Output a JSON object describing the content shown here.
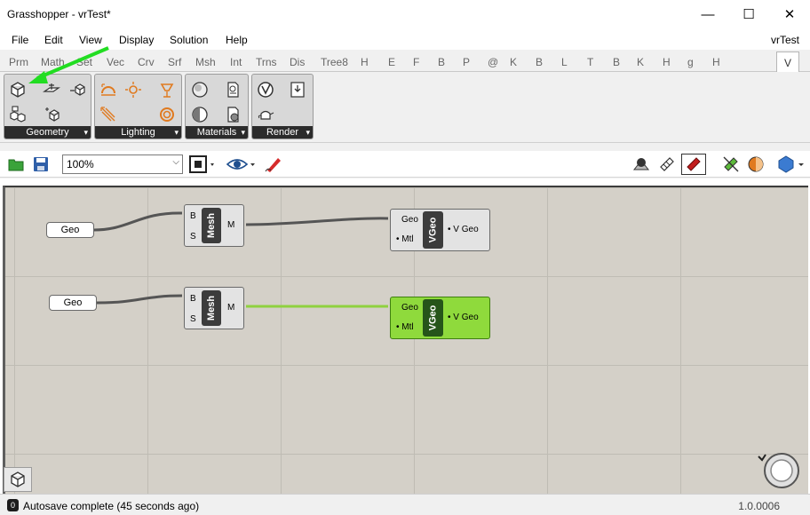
{
  "window": {
    "title": "Grasshopper - vrTest*",
    "file_name": "vrTest",
    "controls": {
      "minimize": "—",
      "maximize": "☐",
      "close": "✕"
    }
  },
  "menu": [
    "File",
    "Edit",
    "View",
    "Display",
    "Solution",
    "Help"
  ],
  "tabs": [
    "Prm",
    "Math",
    "Set",
    "Vec",
    "Crv",
    "Srf",
    "Msh",
    "Int",
    "Trns",
    "Dis",
    "Tree8",
    "H",
    "E",
    "F",
    "B",
    "P",
    "@",
    "K",
    "B",
    "L",
    "T",
    "B",
    "K",
    "H",
    "g",
    "H"
  ],
  "active_tab": "V",
  "ribbon": {
    "panels": [
      {
        "label": "Geometry",
        "dropdown": "▾"
      },
      {
        "label": "Lighting",
        "dropdown": "▾"
      },
      {
        "label": "Materials",
        "dropdown": "▾"
      },
      {
        "label": "Render",
        "dropdown": "▾"
      }
    ]
  },
  "toolbar": {
    "zoom_value": "100%",
    "chevron": "⌵"
  },
  "canvas": {
    "params": [
      {
        "label": "Geo"
      },
      {
        "label": "Geo"
      }
    ],
    "mesh_components": [
      {
        "name": "Mesh",
        "inputs": [
          "B",
          "S"
        ],
        "output": "M"
      },
      {
        "name": "Mesh",
        "inputs": [
          "B",
          "S"
        ],
        "output": "M"
      }
    ],
    "vgeo_components": [
      {
        "name": "VGeo",
        "inputs": [
          "Geo",
          "• Mtl"
        ],
        "output": "• V Geo",
        "selected": false
      },
      {
        "name": "VGeo",
        "inputs": [
          "Geo",
          "• Mtl"
        ],
        "output": "• V Geo",
        "selected": true
      }
    ]
  },
  "status": {
    "icon": "0",
    "message": "Autosave complete (45 seconds ago)",
    "version": "1.0.0006"
  },
  "colors": {
    "accent_arrow": "#22dd22",
    "selected_component": "#8fda3c",
    "wire_selected": "#8fd13f",
    "wire_default": "#555555",
    "icon_orange": "#e07a1f"
  }
}
